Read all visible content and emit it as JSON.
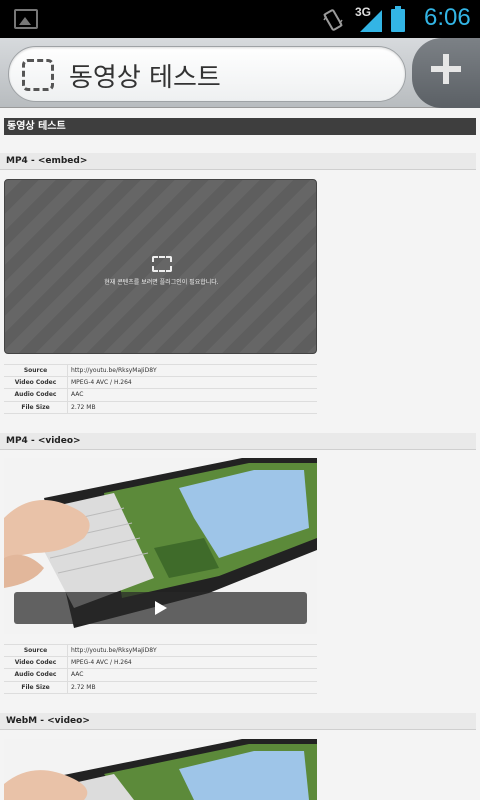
{
  "status_bar": {
    "network": "3G",
    "time": "6:06"
  },
  "browser": {
    "tab_title": "동영상 테스트"
  },
  "page": {
    "header": "동영상 테스트",
    "sections": [
      {
        "title": "MP4 - <embed>",
        "plugin_message": "현재 콘텐츠를 보려면 플러그인이 필요합니다.",
        "meta": [
          {
            "key": "Source",
            "value": "http://youtu.be/RksyMaJiD8Y"
          },
          {
            "key": "Video Codec",
            "value": "MPEG-4 AVC / H.264"
          },
          {
            "key": "Audio Codec",
            "value": "AAC"
          },
          {
            "key": "File Size",
            "value": "2.72 MB"
          }
        ]
      },
      {
        "title": "MP4 - <video>",
        "meta": [
          {
            "key": "Source",
            "value": "http://youtu.be/RksyMaJiD8Y"
          },
          {
            "key": "Video Codec",
            "value": "MPEG-4 AVC / H.264"
          },
          {
            "key": "Audio Codec",
            "value": "AAC"
          },
          {
            "key": "File Size",
            "value": "2.72 MB"
          }
        ]
      },
      {
        "title": "WebM - <video>"
      }
    ]
  },
  "colors": {
    "status_accent": "#33b5e5",
    "header_bg": "#3e3e3e"
  }
}
